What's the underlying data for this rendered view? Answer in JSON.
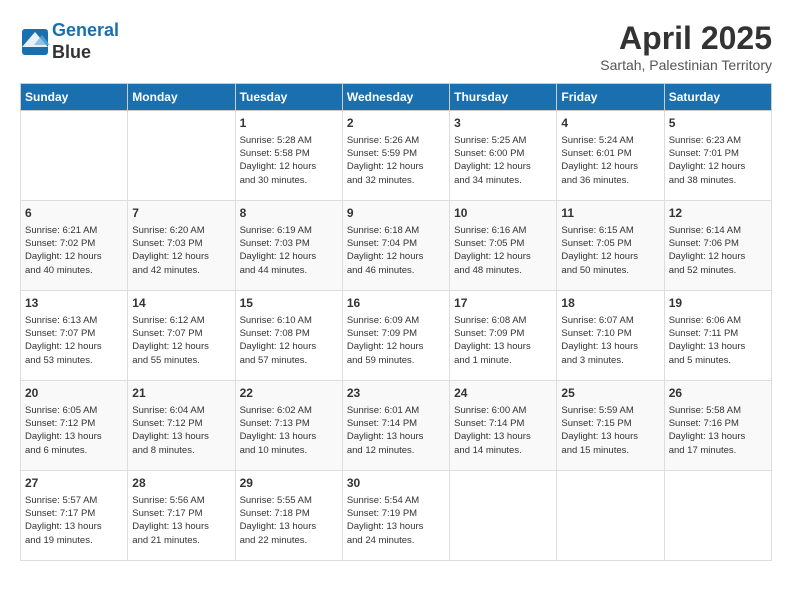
{
  "header": {
    "logo_line1": "General",
    "logo_line2": "Blue",
    "month_title": "April 2025",
    "subtitle": "Sartah, Palestinian Territory"
  },
  "days_of_week": [
    "Sunday",
    "Monday",
    "Tuesday",
    "Wednesday",
    "Thursday",
    "Friday",
    "Saturday"
  ],
  "weeks": [
    [
      {
        "day": "",
        "info": ""
      },
      {
        "day": "",
        "info": ""
      },
      {
        "day": "1",
        "info": "Sunrise: 5:28 AM\nSunset: 5:58 PM\nDaylight: 12 hours\nand 30 minutes."
      },
      {
        "day": "2",
        "info": "Sunrise: 5:26 AM\nSunset: 5:59 PM\nDaylight: 12 hours\nand 32 minutes."
      },
      {
        "day": "3",
        "info": "Sunrise: 5:25 AM\nSunset: 6:00 PM\nDaylight: 12 hours\nand 34 minutes."
      },
      {
        "day": "4",
        "info": "Sunrise: 5:24 AM\nSunset: 6:01 PM\nDaylight: 12 hours\nand 36 minutes."
      },
      {
        "day": "5",
        "info": "Sunrise: 6:23 AM\nSunset: 7:01 PM\nDaylight: 12 hours\nand 38 minutes."
      }
    ],
    [
      {
        "day": "6",
        "info": "Sunrise: 6:21 AM\nSunset: 7:02 PM\nDaylight: 12 hours\nand 40 minutes."
      },
      {
        "day": "7",
        "info": "Sunrise: 6:20 AM\nSunset: 7:03 PM\nDaylight: 12 hours\nand 42 minutes."
      },
      {
        "day": "8",
        "info": "Sunrise: 6:19 AM\nSunset: 7:03 PM\nDaylight: 12 hours\nand 44 minutes."
      },
      {
        "day": "9",
        "info": "Sunrise: 6:18 AM\nSunset: 7:04 PM\nDaylight: 12 hours\nand 46 minutes."
      },
      {
        "day": "10",
        "info": "Sunrise: 6:16 AM\nSunset: 7:05 PM\nDaylight: 12 hours\nand 48 minutes."
      },
      {
        "day": "11",
        "info": "Sunrise: 6:15 AM\nSunset: 7:05 PM\nDaylight: 12 hours\nand 50 minutes."
      },
      {
        "day": "12",
        "info": "Sunrise: 6:14 AM\nSunset: 7:06 PM\nDaylight: 12 hours\nand 52 minutes."
      }
    ],
    [
      {
        "day": "13",
        "info": "Sunrise: 6:13 AM\nSunset: 7:07 PM\nDaylight: 12 hours\nand 53 minutes."
      },
      {
        "day": "14",
        "info": "Sunrise: 6:12 AM\nSunset: 7:07 PM\nDaylight: 12 hours\nand 55 minutes."
      },
      {
        "day": "15",
        "info": "Sunrise: 6:10 AM\nSunset: 7:08 PM\nDaylight: 12 hours\nand 57 minutes."
      },
      {
        "day": "16",
        "info": "Sunrise: 6:09 AM\nSunset: 7:09 PM\nDaylight: 12 hours\nand 59 minutes."
      },
      {
        "day": "17",
        "info": "Sunrise: 6:08 AM\nSunset: 7:09 PM\nDaylight: 13 hours\nand 1 minute."
      },
      {
        "day": "18",
        "info": "Sunrise: 6:07 AM\nSunset: 7:10 PM\nDaylight: 13 hours\nand 3 minutes."
      },
      {
        "day": "19",
        "info": "Sunrise: 6:06 AM\nSunset: 7:11 PM\nDaylight: 13 hours\nand 5 minutes."
      }
    ],
    [
      {
        "day": "20",
        "info": "Sunrise: 6:05 AM\nSunset: 7:12 PM\nDaylight: 13 hours\nand 6 minutes."
      },
      {
        "day": "21",
        "info": "Sunrise: 6:04 AM\nSunset: 7:12 PM\nDaylight: 13 hours\nand 8 minutes."
      },
      {
        "day": "22",
        "info": "Sunrise: 6:02 AM\nSunset: 7:13 PM\nDaylight: 13 hours\nand 10 minutes."
      },
      {
        "day": "23",
        "info": "Sunrise: 6:01 AM\nSunset: 7:14 PM\nDaylight: 13 hours\nand 12 minutes."
      },
      {
        "day": "24",
        "info": "Sunrise: 6:00 AM\nSunset: 7:14 PM\nDaylight: 13 hours\nand 14 minutes."
      },
      {
        "day": "25",
        "info": "Sunrise: 5:59 AM\nSunset: 7:15 PM\nDaylight: 13 hours\nand 15 minutes."
      },
      {
        "day": "26",
        "info": "Sunrise: 5:58 AM\nSunset: 7:16 PM\nDaylight: 13 hours\nand 17 minutes."
      }
    ],
    [
      {
        "day": "27",
        "info": "Sunrise: 5:57 AM\nSunset: 7:17 PM\nDaylight: 13 hours\nand 19 minutes."
      },
      {
        "day": "28",
        "info": "Sunrise: 5:56 AM\nSunset: 7:17 PM\nDaylight: 13 hours\nand 21 minutes."
      },
      {
        "day": "29",
        "info": "Sunrise: 5:55 AM\nSunset: 7:18 PM\nDaylight: 13 hours\nand 22 minutes."
      },
      {
        "day": "30",
        "info": "Sunrise: 5:54 AM\nSunset: 7:19 PM\nDaylight: 13 hours\nand 24 minutes."
      },
      {
        "day": "",
        "info": ""
      },
      {
        "day": "",
        "info": ""
      },
      {
        "day": "",
        "info": ""
      }
    ]
  ]
}
